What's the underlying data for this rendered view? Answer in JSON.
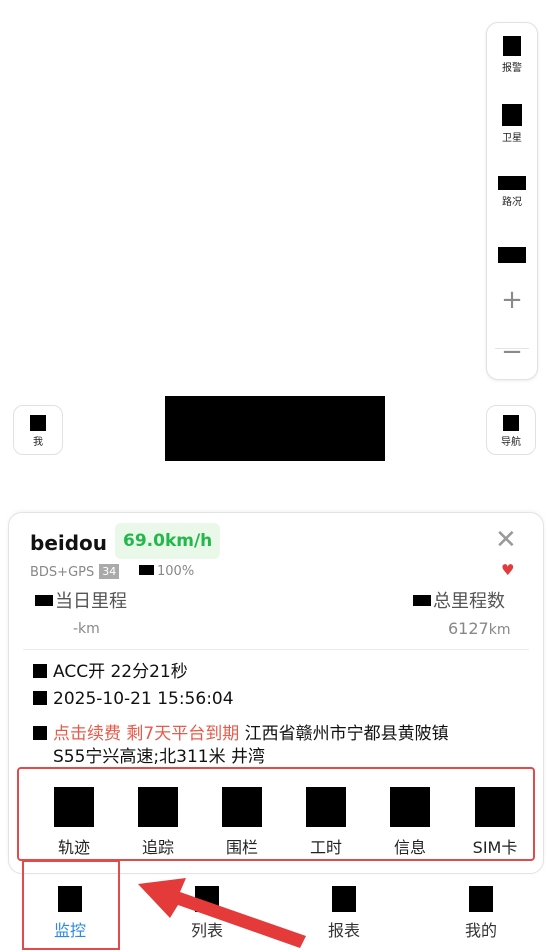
{
  "map_tools": [
    {
      "label": "报警",
      "icon": "alarm-icon"
    },
    {
      "label": "卫星",
      "icon": "satellite-icon"
    },
    {
      "label": "路况",
      "icon": "traffic-icon"
    },
    {
      "label": "",
      "icon": "layers-icon"
    }
  ],
  "zoom": {
    "in": "+",
    "out": "−"
  },
  "me_button": {
    "label": "我",
    "icon": "my-location-icon"
  },
  "nav_button": {
    "label": "导航",
    "icon": "navigation-icon"
  },
  "device": {
    "name": "beidou",
    "speed": "69.0km/h",
    "gnss": "BDS+GPS",
    "satellites": "34",
    "battery": "100%",
    "close_icon": "close-icon",
    "favorite_icon": "heart-icon",
    "favorite_color": "#e23b3b",
    "speed_color": "#22b84a"
  },
  "mileage": {
    "day_label": "当日里程",
    "day_value": "-km",
    "total_label": "总里程数",
    "total_value": "6127",
    "total_unit": "km"
  },
  "status": {
    "acc": "ACC开 22分21秒",
    "time": "2025-10-21 15:56:04",
    "renew_text": "点击续费 剩7天平台到期",
    "renew_color": "#ea5a4a",
    "address_line1": " 江西省赣州市宁都县黄陂镇",
    "address_line2": "S55宁兴高速;北311米 井湾"
  },
  "actions": [
    {
      "label": "轨迹",
      "icon": "track-icon"
    },
    {
      "label": "追踪",
      "icon": "follow-icon"
    },
    {
      "label": "围栏",
      "icon": "fence-icon"
    },
    {
      "label": "工时",
      "icon": "worktime-icon"
    },
    {
      "label": "信息",
      "icon": "info-icon"
    },
    {
      "label": "SIM卡",
      "icon": "sim-card-icon"
    }
  ],
  "tabs": [
    {
      "label": "监控",
      "icon": "monitor-icon",
      "active": true
    },
    {
      "label": "列表",
      "icon": "list-icon"
    },
    {
      "label": "报表",
      "icon": "report-icon"
    },
    {
      "label": "我的",
      "icon": "profile-icon"
    }
  ],
  "accent_color": "#2b8ae6",
  "highlight_color": "#e34a4a"
}
